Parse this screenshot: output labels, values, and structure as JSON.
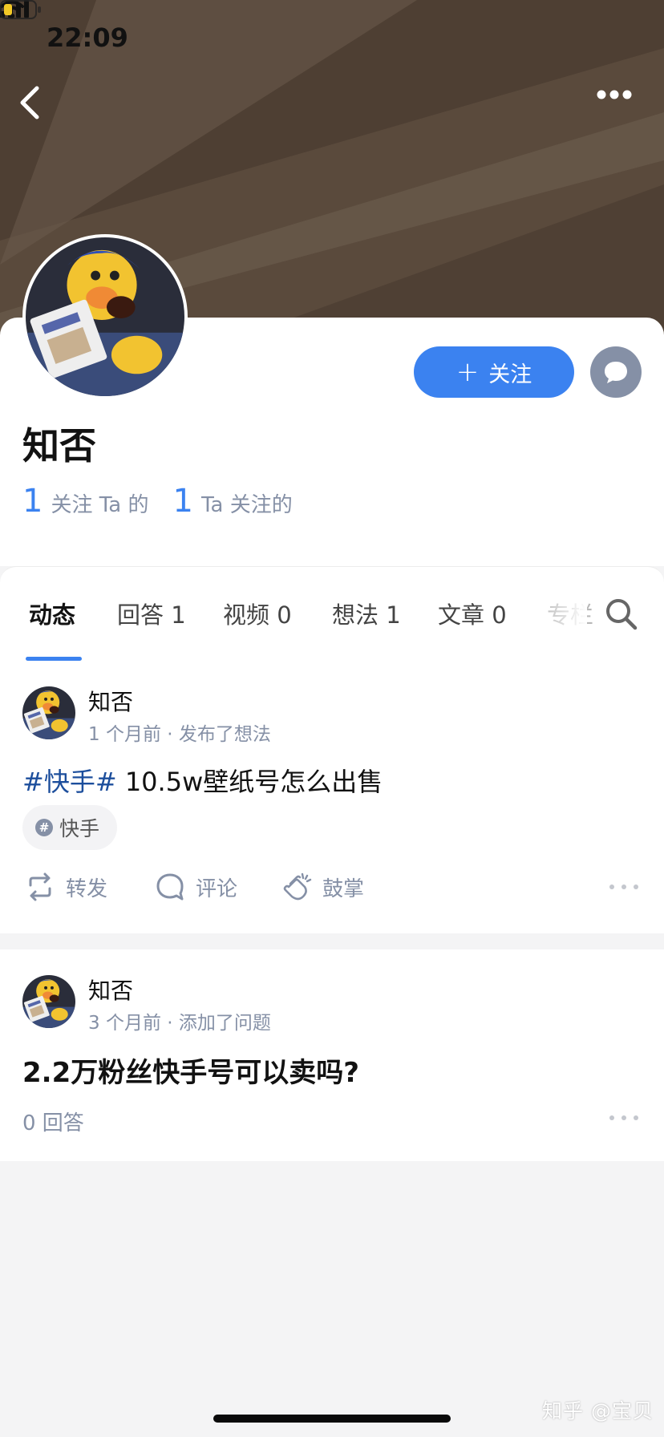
{
  "status_bar": {
    "time": "22:09"
  },
  "colors": {
    "accent": "#3b82f0",
    "hashtag": "#1c4e9c",
    "muted": "#8590a6"
  },
  "header": {
    "back_icon": "chevron-left-icon",
    "more_icon": "more-dots-icon"
  },
  "profile": {
    "name": "知否",
    "follow_button": "关注",
    "message_icon": "chat-bubble-icon",
    "stats": [
      {
        "count": "1",
        "label": "关注 Ta 的"
      },
      {
        "count": "1",
        "label": "Ta 关注的"
      }
    ]
  },
  "tabs": [
    "动态",
    "回答 1",
    "视频 0",
    "想法 1",
    "文章 0",
    "专栏"
  ],
  "active_tab": "动态",
  "feed": [
    {
      "author": "知否",
      "meta": "1 个月前 · 发布了想法",
      "hashtag": "#快手#",
      "text": " 10.5w壁纸号怎么出售",
      "topic": "快手",
      "actions": {
        "repost": "转发",
        "comment": "评论",
        "clap": "鼓掌"
      }
    },
    {
      "author": "知否",
      "meta": "3 个月前 · 添加了问题",
      "title": "2.2万粉丝快手号可以卖吗?",
      "answers": "0 回答"
    }
  ],
  "watermark": "知乎 @宝贝"
}
